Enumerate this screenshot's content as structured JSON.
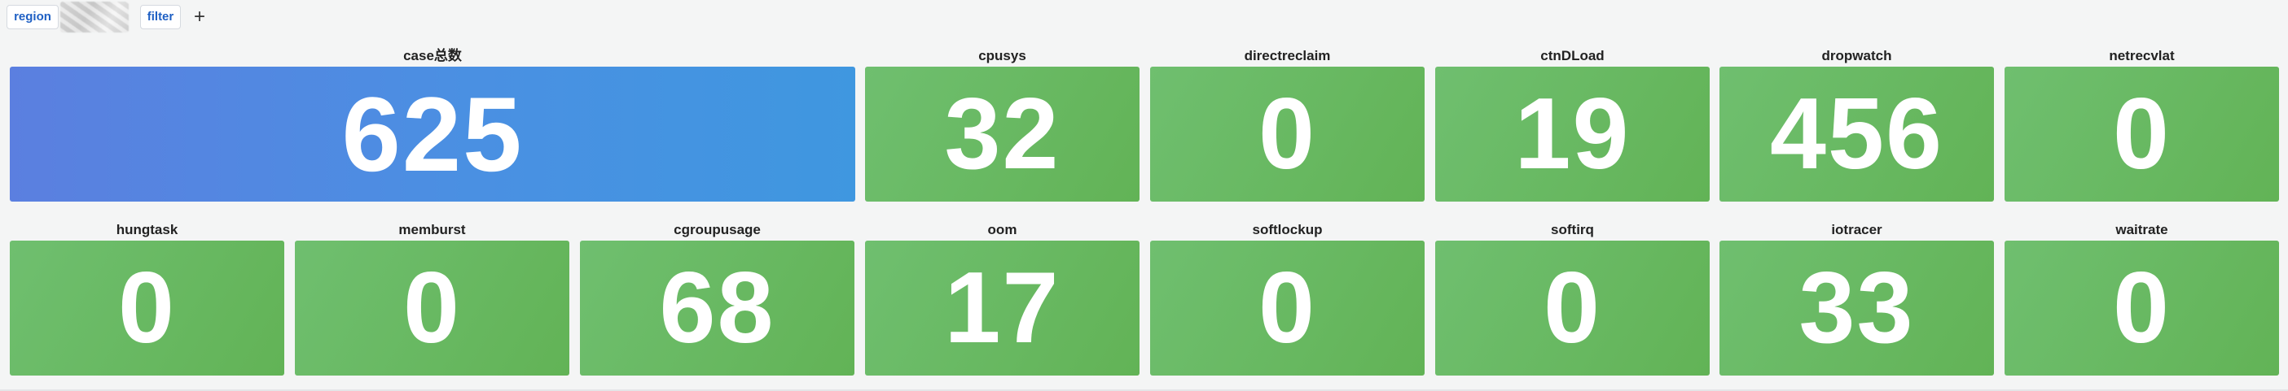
{
  "toolbar": {
    "region_label": "region",
    "filter_label": "filter",
    "add_label": "+"
  },
  "colors": {
    "green": "#62b356",
    "blue": "#4a90e2"
  },
  "panels": [
    {
      "title": "case总数",
      "value": "625"
    },
    {
      "title": "cpusys",
      "value": "32"
    },
    {
      "title": "directreclaim",
      "value": "0"
    },
    {
      "title": "ctnDLoad",
      "value": "19"
    },
    {
      "title": "dropwatch",
      "value": "456"
    },
    {
      "title": "netrecvlat",
      "value": "0"
    },
    {
      "title": "hungtask",
      "value": "0"
    },
    {
      "title": "memburst",
      "value": "0"
    },
    {
      "title": "cgroupusage",
      "value": "68"
    },
    {
      "title": "oom",
      "value": "17"
    },
    {
      "title": "softlockup",
      "value": "0"
    },
    {
      "title": "softirq",
      "value": "0"
    },
    {
      "title": "iotracer",
      "value": "33"
    },
    {
      "title": "waitrate",
      "value": "0"
    }
  ]
}
